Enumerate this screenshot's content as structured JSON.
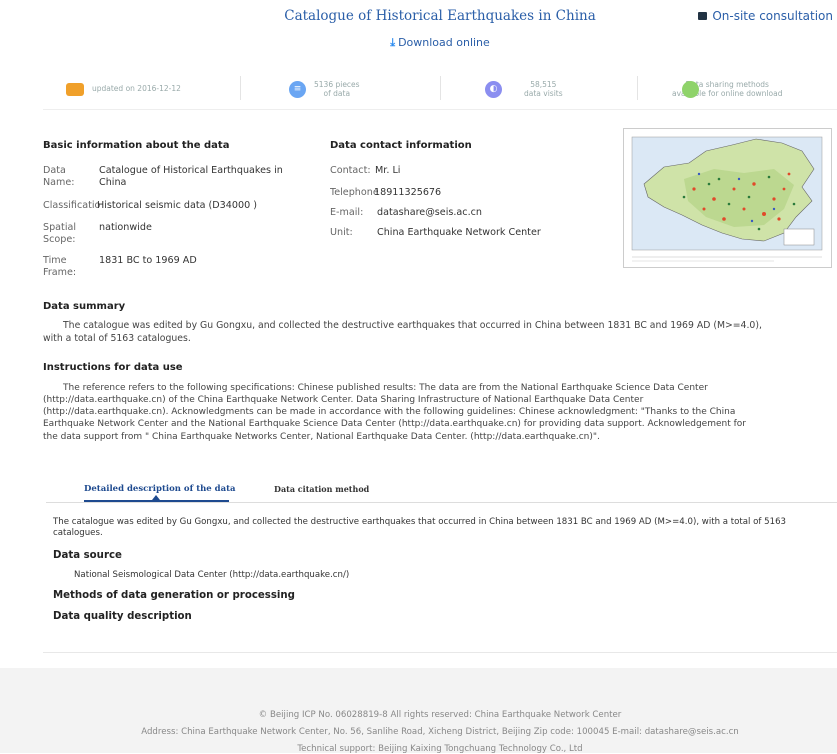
{
  "header": {
    "title": "Catalogue of Historical Earthquakes in China",
    "consult_label": "On-site consultation",
    "download_label": "Download online"
  },
  "stats": {
    "updated": "updated on 2016-12-12",
    "pieces_line1": "5136 pieces",
    "pieces_line2": "of data",
    "visits_line1": "58,515",
    "visits_line2": "data visits",
    "sharing_line1": "Data sharing methods",
    "sharing_line2": "available for online download",
    "colors": {
      "updated": "#f0a02a",
      "pieces": "#6aa6f3",
      "visits": "#8b8ef0",
      "sharing": "#8fd36a"
    }
  },
  "basic": {
    "heading": "Basic information about the data",
    "name_label_1": "Data",
    "name_label_2": "Name:",
    "name_value_1": "Catalogue of Historical Earthquakes in",
    "name_value_2": "China",
    "class_label": "Classification:",
    "class_value": "Historical seismic data (D34000 )",
    "scope_label_1": "Spatial",
    "scope_label_2": "Scope:",
    "scope_value": "nationwide",
    "time_label_1": "Time",
    "time_label_2": "Frame:",
    "time_value": "1831 BC to 1969 AD"
  },
  "contact": {
    "heading": "Data contact information",
    "contact_label": "Contact:",
    "contact_value": "Mr. Li",
    "tel_label": "Telephone:",
    "tel_value": "18911325676",
    "email_label": "E-mail:",
    "email_value": "datashare@seis.ac.cn",
    "unit_label": "Unit:",
    "unit_value": "China Earthquake Network Center"
  },
  "summary": {
    "heading": "Data summary",
    "line1": "The catalogue was edited by Gu Gongxu, and collected the destructive earthquakes that occurred in China between 1831 BC and 1969 AD (M>=4.0),",
    "line2": "with a total of 5163 catalogues."
  },
  "instructions": {
    "heading": "Instructions for data use",
    "line1": "The reference refers to the following specifications: Chinese published results: The data are from the National Earthquake Science Data Center",
    "line2": "(http://data.earthquake.cn) of the China Earthquake Network Center. Data Sharing Infrastructure of National Earthquake Data Center",
    "line3": "(http://data.earthquake.cn). Acknowledgments can be made in accordance with the following guidelines: Chinese acknowledgment: \"Thanks to the China",
    "line4": "Earthquake Network Center and the National Earthquake Science Data Center (http://data.earthquake.cn) for providing data support. Acknowledgement for",
    "line5": "the data support from \" China Earthquake Networks Center, National Earthquake Data Center. (http://data.earthquake.cn)\"."
  },
  "tabs": {
    "detailed": "Detailed description of the data",
    "citation": "Data citation method",
    "active_color": "#1e4a8f"
  },
  "description": {
    "line1": "The catalogue was edited by Gu Gongxu, and collected the destructive earthquakes that occurred in China between 1831 BC and 1969 AD (M>=4.0), with a total of 5163",
    "line2": "catalogues.",
    "source_heading": "Data source",
    "source_value": "National Seismological Data Center (http://data.earthquake.cn/)",
    "methods_heading": "Methods of data generation or processing",
    "quality_heading": "Data quality description"
  },
  "footer": {
    "line1": "© Beijing ICP No. 06028819-8 All rights reserved: China Earthquake Network Center",
    "line2": "Address: China Earthquake Network Center, No. 56, Sanlihe Road, Xicheng District, Beijing Zip code: 100045 E-mail: datashare@seis.ac.cn",
    "line3": "Technical support: Beijing Kaixing Tongchuang Technology Co., Ltd"
  },
  "icons": {
    "consult": "chat-icon",
    "download": "download-icon",
    "updated": "calendar-icon",
    "pieces": "database-icon",
    "visits": "eye-icon",
    "sharing": "share-icon"
  }
}
